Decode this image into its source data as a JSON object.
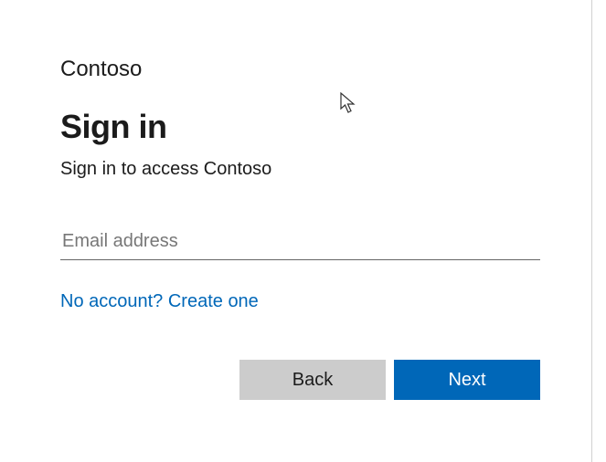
{
  "brand": "Contoso",
  "heading": "Sign in",
  "subheading": "Sign in to access Contoso",
  "email_input": {
    "placeholder": "Email address",
    "value": ""
  },
  "create_account_link": "No account? Create one",
  "buttons": {
    "back": "Back",
    "next": "Next"
  }
}
